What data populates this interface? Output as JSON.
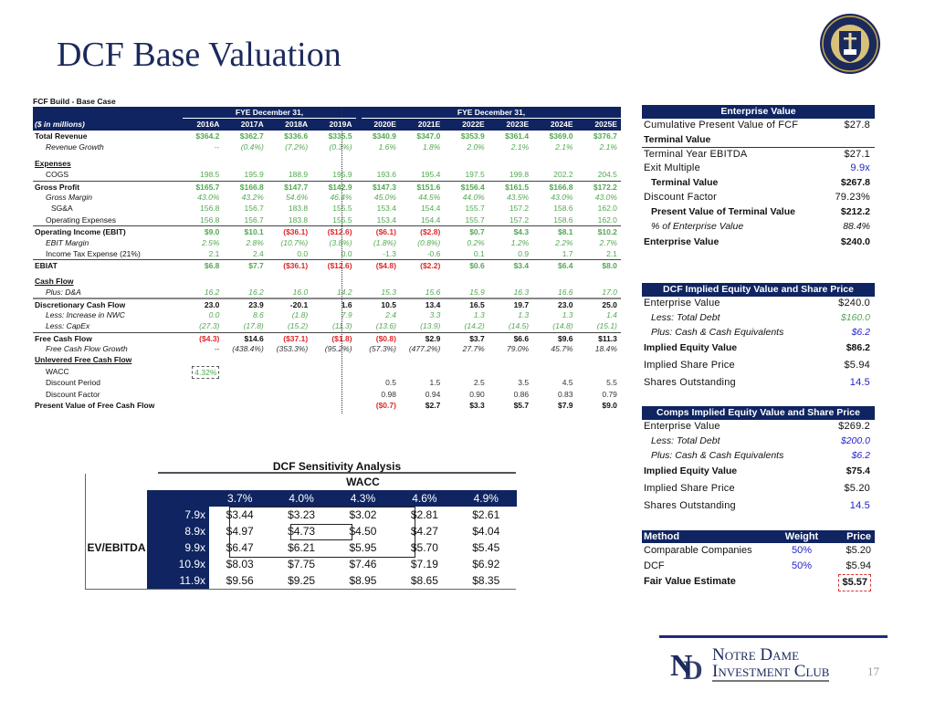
{
  "title": "DCF Base Valuation",
  "seal_text": "SIGILLUM UNIVERSITATIS DOMINAE NOSTRAE A LACU",
  "fcf": {
    "caption": "FCF Build - Base Case",
    "group_label": "FYE December 31,",
    "units_label": "($ in millions)",
    "years": [
      "2016A",
      "2017A",
      "2018A",
      "2019A",
      "2020E",
      "2021E",
      "2022E",
      "2023E",
      "2024E",
      "2025E"
    ],
    "rows": [
      {
        "label": "Total Revenue",
        "style": "b",
        "color": "green",
        "values": [
          "$364.2",
          "$362.7",
          "$336.6",
          "$335.5",
          "$340.9",
          "$347.0",
          "$353.9",
          "$361.4",
          "$369.0",
          "$376.7"
        ]
      },
      {
        "label": "Revenue Growth",
        "style": "i ind",
        "color": "green",
        "values": [
          "--",
          "(0.4%)",
          "(7.2%)",
          "(0.3%)",
          "1.6%",
          "1.8%",
          "2.0%",
          "2.1%",
          "2.1%",
          "2.1%"
        ]
      },
      {
        "label": "Expenses",
        "style": "u",
        "color": "black",
        "values": []
      },
      {
        "label": "COGS",
        "style": "ind",
        "color": "green",
        "values": [
          "198.5",
          "195.9",
          "188.9",
          "195.9",
          "193.6",
          "195.4",
          "197.5",
          "199.8",
          "202.2",
          "204.5"
        ]
      },
      {
        "label": "Gross Profit",
        "style": "b",
        "color": "green",
        "values": [
          "$165.7",
          "$166.8",
          "$147.7",
          "$142.9",
          "$147.3",
          "$151.6",
          "$156.4",
          "$161.5",
          "$166.8",
          "$172.2"
        ]
      },
      {
        "label": "Gross Margin",
        "style": "i ind",
        "color": "green",
        "values": [
          "43.0%",
          "43.2%",
          "54.6%",
          "46.4%",
          "45.0%",
          "44.5%",
          "44.0%",
          "43.5%",
          "43.0%",
          "43.0%"
        ]
      },
      {
        "label": "SG&A",
        "style": "ind2",
        "color": "green",
        "values": [
          "156.8",
          "156.7",
          "183.8",
          "155.5",
          "153.4",
          "154.4",
          "155.7",
          "157.2",
          "158.6",
          "162.0"
        ]
      },
      {
        "label": "Operating Expenses",
        "style": "ind",
        "color": "green",
        "values": [
          "156.8",
          "156.7",
          "183.8",
          "155.5",
          "153.4",
          "154.4",
          "155.7",
          "157.2",
          "158.6",
          "162.0"
        ]
      },
      {
        "label": "Operating Income (EBIT)",
        "style": "b",
        "color": "green",
        "values": [
          "$9.0",
          "$10.1",
          "($36.1)",
          "($12.6)",
          "($6.1)",
          "($2.8)",
          "$0.7",
          "$4.3",
          "$8.1",
          "$10.2"
        ]
      },
      {
        "label": "EBIT Margin",
        "style": "i ind",
        "color": "green",
        "values": [
          "2.5%",
          "2.8%",
          "(10.7%)",
          "(3.8%)",
          "(1.8%)",
          "(0.8%)",
          "0.2%",
          "1.2%",
          "2.2%",
          "2.7%"
        ]
      },
      {
        "label": "Income Tax Expense (21%)",
        "style": "ind",
        "color": "green",
        "values": [
          "2.1",
          "2.4",
          "0.0",
          "0.0",
          "-1.3",
          "-0.6",
          "0.1",
          "0.9",
          "1.7",
          "2.1"
        ]
      },
      {
        "label": "EBIAT",
        "style": "b",
        "color": "green",
        "values": [
          "$6.8",
          "$7.7",
          "($36.1)",
          "($12.6)",
          "($4.8)",
          "($2.2)",
          "$0.6",
          "$3.4",
          "$6.4",
          "$8.0"
        ]
      },
      {
        "label": "Cash Flow",
        "style": "u",
        "color": "black",
        "values": []
      },
      {
        "label": "Plus: D&A",
        "style": "i ind",
        "color": "green",
        "values": [
          "16.2",
          "16.2",
          "16.0",
          "14.2",
          "15.3",
          "15.6",
          "15.9",
          "16.3",
          "16.6",
          "17.0"
        ]
      },
      {
        "label": "Discretionary Cash Flow",
        "style": "b",
        "color": "black",
        "values": [
          "23.0",
          "23.9",
          "-20.1",
          "1.6",
          "10.5",
          "13.4",
          "16.5",
          "19.7",
          "23.0",
          "25.0"
        ]
      },
      {
        "label": "Less: Increase in NWC",
        "style": "i ind",
        "color": "green",
        "values": [
          "0.0",
          "8.6",
          "(1.8)",
          "7.9",
          "2.4",
          "3.3",
          "1.3",
          "1.3",
          "1.3",
          "1.4"
        ]
      },
      {
        "label": "Less: CapEx",
        "style": "i ind",
        "color": "green",
        "values": [
          "(27.3)",
          "(17.8)",
          "(15.2)",
          "(11.3)",
          "(13.6)",
          "(13.9)",
          "(14.2)",
          "(14.5)",
          "(14.8)",
          "(15.1)"
        ]
      },
      {
        "label": "Free Cash Flow",
        "style": "b",
        "color": "black",
        "values": [
          "($4.3)",
          "$14.6",
          "($37.1)",
          "($1.8)",
          "($0.8)",
          "$2.9",
          "$3.7",
          "$6.6",
          "$9.6",
          "$11.3"
        ]
      },
      {
        "label": "Free Cash Flow Growth",
        "style": "i ind",
        "color": "gray",
        "values": [
          "--",
          "(438.4%)",
          "(353.3%)",
          "(95.2%)",
          "(57.3%)",
          "(477.2%)",
          "27.7%",
          "79.0%",
          "45.7%",
          "18.4%"
        ]
      },
      {
        "label": "Unlevered Free Cash Flow",
        "style": "u",
        "color": "black",
        "values": []
      },
      {
        "label": "WACC",
        "style": "ind",
        "color": "green",
        "values": [
          "4.32%"
        ]
      },
      {
        "label": "Discount Period",
        "style": "ind",
        "color": "gray",
        "values": [
          "",
          "",
          "",
          "",
          "0.5",
          "1.5",
          "2.5",
          "3.5",
          "4.5",
          "5.5"
        ]
      },
      {
        "label": "Discount Factor",
        "style": "ind",
        "color": "gray",
        "values": [
          "",
          "",
          "",
          "",
          "0.98",
          "0.94",
          "0.90",
          "0.86",
          "0.83",
          "0.79"
        ]
      },
      {
        "label": "Present Value of Free Cash Flow",
        "style": "b",
        "color": "black",
        "values": [
          "",
          "",
          "",
          "",
          "($0.7)",
          "$2.7",
          "$3.3",
          "$5.7",
          "$7.9",
          "$9.0"
        ]
      }
    ]
  },
  "panels": [
    {
      "title": "Enterprise Value",
      "rows": [
        {
          "label": "Cumulative Present Value of FCF",
          "value": "$27.8",
          "style": ""
        },
        {
          "label": "Terminal Value",
          "value": "",
          "style": "bold rule"
        },
        {
          "label": "Terminal Year EBITDA",
          "value": "$27.1",
          "style": ""
        },
        {
          "label": "Exit Multiple",
          "value": "9.9x",
          "style": "",
          "color": "blue"
        },
        {
          "label": "Terminal Value",
          "value": "$267.8",
          "style": "bi"
        },
        {
          "label": "Discount Factor",
          "value": "79.23%",
          "style": ""
        },
        {
          "label": "Present Value of Terminal Value",
          "value": "$212.2",
          "style": "bi"
        },
        {
          "label": "% of Enterprise Value",
          "value": "88.4%",
          "style": "ii"
        },
        {
          "label": "Enterprise Value",
          "value": "$240.0",
          "style": "bold tall"
        }
      ]
    },
    {
      "title": "DCF Implied Equity Value and Share Price",
      "rows": [
        {
          "label": "Enterprise Value",
          "value": "$240.0",
          "style": ""
        },
        {
          "label": "Less: Total Debt",
          "value": "$160.0",
          "style": "ii",
          "color": "green"
        },
        {
          "label": "Plus: Cash & Cash Equivalents",
          "value": "$6.2",
          "style": "ii",
          "color": "blue"
        },
        {
          "label": "Implied Equity Value",
          "value": "$86.2",
          "style": "bold tall"
        },
        {
          "label": "Implied Share Price",
          "value": "$5.94",
          "style": "tall"
        },
        {
          "label": "Shares Outstanding",
          "value": "14.5",
          "style": "tall",
          "color": "blue"
        }
      ]
    },
    {
      "title": "Comps Implied Equity Value and Share Price",
      "rows": [
        {
          "label": "Enterprise Value",
          "value": "$269.2",
          "style": ""
        },
        {
          "label": "Less: Total Debt",
          "value": "$200.0",
          "style": "ii",
          "color": "blue"
        },
        {
          "label": "Plus: Cash & Cash Equivalents",
          "value": "$6.2",
          "style": "ii",
          "color": "blue"
        },
        {
          "label": "Implied Equity Value",
          "value": "$75.4",
          "style": "bold tall"
        },
        {
          "label": "Implied Share Price",
          "value": "$5.20",
          "style": "tall"
        },
        {
          "label": "Shares Outstanding",
          "value": "14.5",
          "style": "tall",
          "color": "blue"
        }
      ]
    }
  ],
  "method": {
    "headers": [
      "Method",
      "Weight",
      "Price"
    ],
    "rows": [
      {
        "method": "Comparable Companies",
        "weight": "50%",
        "price": "$5.20"
      },
      {
        "method": "DCF",
        "weight": "50%",
        "price": "$5.94"
      }
    ],
    "fair_value_label": "Fair Value Estimate",
    "fair_value": "$5.57"
  },
  "sensitivity": {
    "title": "DCF Sensitivity Analysis",
    "col_axis": "WACC",
    "row_axis": "EV/EBITDA",
    "wacc": [
      "3.7%",
      "4.0%",
      "4.3%",
      "4.6%",
      "4.9%"
    ],
    "multiples": [
      "7.9x",
      "8.9x",
      "9.9x",
      "10.9x",
      "11.9x"
    ],
    "values": [
      [
        "$3.44",
        "$3.23",
        "$3.02",
        "$2.81",
        "$2.61"
      ],
      [
        "$4.97",
        "$4.73",
        "$4.50",
        "$4.27",
        "$4.04"
      ],
      [
        "$6.47",
        "$6.21",
        "$5.95",
        "$5.70",
        "$5.45"
      ],
      [
        "$8.03",
        "$7.75",
        "$7.46",
        "$7.19",
        "$6.92"
      ],
      [
        "$9.56",
        "$9.25",
        "$8.95",
        "$8.65",
        "$8.35"
      ]
    ]
  },
  "footer": {
    "logo_line1": "Notre Dame",
    "logo_line2": "Investment Club",
    "page_number": "17"
  },
  "colors": {
    "navy": "#0f2461",
    "green": "#52a852",
    "red": "#e02828",
    "blue": "#2222cc"
  }
}
